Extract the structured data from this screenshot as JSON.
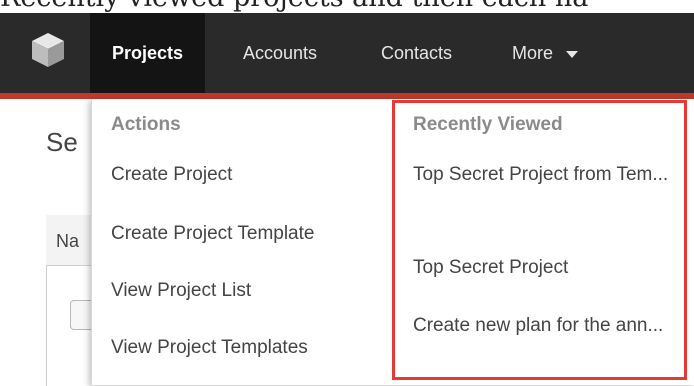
{
  "caption": "Recently viewed projects and then each ha",
  "nav": {
    "items": [
      {
        "label": "Projects",
        "active": true
      },
      {
        "label": "Accounts",
        "active": false
      },
      {
        "label": "Contacts",
        "active": false
      },
      {
        "label": "More",
        "active": false
      }
    ]
  },
  "page": {
    "title_fragment": "Se",
    "table_header_fragment": "Na"
  },
  "dropdown": {
    "actions_header": "Actions",
    "actions": [
      "Create Project",
      "Create Project Template",
      "View Project List",
      "View Project Templates"
    ],
    "recent_header": "Recently Viewed",
    "recent": [
      "Top Secret Project from Tem...",
      "Top Secret Project",
      "Create new plan for the ann..."
    ]
  },
  "colors": {
    "navbar": "#2a2a2a",
    "nav_accent": "#c0392b",
    "highlight": "#e53935"
  }
}
